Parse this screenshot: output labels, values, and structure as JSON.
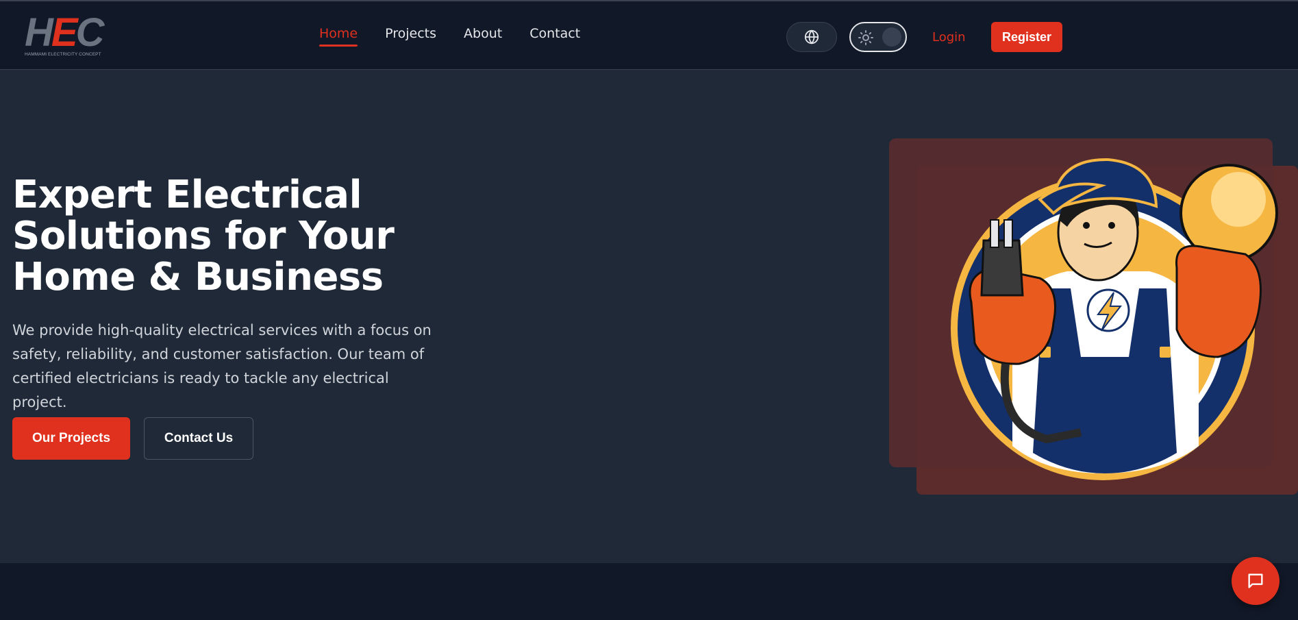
{
  "brand": {
    "logo_h": "H",
    "logo_e": "E",
    "logo_c": "C",
    "logo_subtitle": "HAMMAMI ELECTRICITY CONCEPT"
  },
  "nav": {
    "links": [
      {
        "label": "Home",
        "active": true
      },
      {
        "label": "Projects",
        "active": false
      },
      {
        "label": "About",
        "active": false
      },
      {
        "label": "Contact",
        "active": false
      }
    ],
    "language_icon": "globe-icon",
    "theme_icon": "sun-icon",
    "login_label": "Login",
    "register_label": "Register"
  },
  "hero": {
    "title": "Expert Electrical Solutions for Your Home & Business",
    "description": "We provide high-quality electrical services with a focus on safety, reliability, and customer satisfaction. Our team of certified electricians is ready to tackle any electrical project.",
    "primary_cta": "Our Projects",
    "secondary_cta": "Contact Us",
    "image": "electrician-mascot"
  },
  "chat": {
    "icon": "chat-bubble-icon"
  },
  "colors": {
    "accent": "#e0301e",
    "nav_bg": "#111827",
    "hero_bg": "#1f2937"
  }
}
